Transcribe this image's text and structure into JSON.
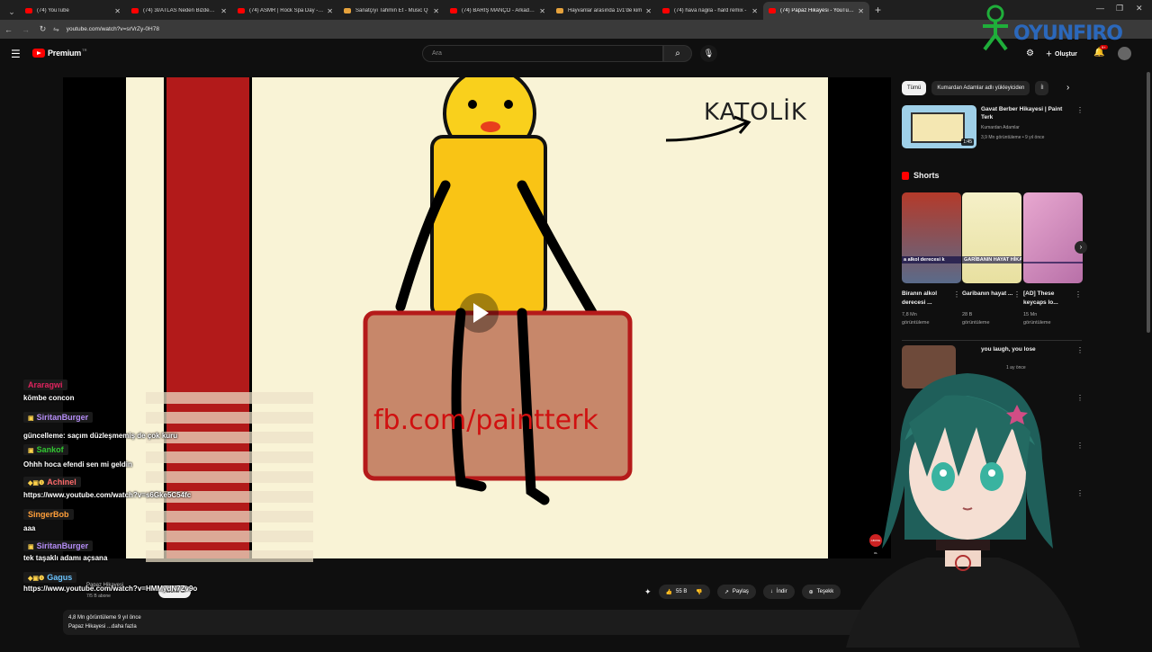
{
  "browser": {
    "tabs": [
      {
        "title": "(74) YouTube",
        "active": false,
        "kind": "yt"
      },
      {
        "title": "(74) 3I/ATLAS Neden Bizden G",
        "active": false,
        "kind": "yt"
      },
      {
        "title": "(74) ASMR | Rock Spa Day - Yo",
        "active": false,
        "kind": "yt"
      },
      {
        "title": "Sanatçıyı Tahmin Et - Music Q",
        "active": false,
        "kind": "other"
      },
      {
        "title": "(74) BARIŞ MANÇO - Arkadaşı",
        "active": false,
        "kind": "yt"
      },
      {
        "title": "Hayvanlar arasında 1v1'de kim",
        "active": false,
        "kind": "other"
      },
      {
        "title": "(74) hava nagila - hard remix -",
        "active": false,
        "kind": "yt"
      },
      {
        "title": "(74) Papaz Hikayesi - YouTube",
        "active": true,
        "kind": "yt"
      }
    ],
    "url": "youtube.com/watch?v=srVrZy-0H78",
    "new_tab": "+"
  },
  "header": {
    "logo_text": "Premium",
    "logo_sup": "TR",
    "search_placeholder": "Ara",
    "create_label": "Oluştur",
    "notif_count": "9+"
  },
  "watermark": {
    "text": "OYUNFIRO"
  },
  "video": {
    "title_sign": "KATOLİK",
    "overlay_text": "fb.com/paintterk",
    "sub_badge": "ABONE OL"
  },
  "below": {
    "channel": "Papaz Hikayesi",
    "subs": "7/5 B abone",
    "subscribe_label": "Abone ol",
    "likes": "55 B",
    "share": "Paylaş",
    "download": "İndir",
    "thanks": "Teşekk",
    "desc_line1": "4,8 Mn görüntüleme  9 yıl önce",
    "desc_line2": "Papaz Hikayesi ...daha fazla"
  },
  "sidebar": {
    "chips": [
      "Tümü",
      "Kumardan Adamlar adlı yükleyiciden",
      "İl"
    ],
    "rec": {
      "title": "Gavat Berber Hikayesi | Paint Terk",
      "channel": "Kumardan Adamlar",
      "meta": "3,9 Mn görüntüleme • 9 yıl önce",
      "duration": "1:45"
    },
    "shorts_header": "Shorts",
    "shorts": [
      {
        "title": "Biranın alkol derecesi ...",
        "views": "7,8 Mn",
        "views2": "görüntüleme",
        "caption": "a alkol derecesi k"
      },
      {
        "title": "Garibanın hayat ...",
        "views": "28 B",
        "views2": "görüntüleme",
        "caption": "GARİBANIN HAYAT HİKAYESİ"
      },
      {
        "title": "[AD] These keycaps lo...",
        "views": "15 Mn",
        "views2": "görüntüleme",
        "caption": ""
      }
    ],
    "recent": {
      "title": "you laugh, you lose",
      "meta": "1 ay önce"
    }
  },
  "chat": [
    {
      "name": "Araragwi",
      "color": "#e0245e",
      "msg": "kömbe concon",
      "badges": ""
    },
    {
      "name": "SiritanBurger",
      "color": "#b48cf5",
      "msg": "güncelleme: saçım düzleşmemiş de çok kuru",
      "badges": "▣"
    },
    {
      "name": "Sankof",
      "color": "#32c832",
      "msg": "Ohhh hoca efendi sen mi geldin",
      "badges": "▣"
    },
    {
      "name": "Achinel",
      "color": "#ff6b6b",
      "msg": "https://www.youtube.com/watch?v=s6Gke5C54fc",
      "badges": "◆▣❶"
    },
    {
      "name": "SingerBob",
      "color": "#ff9f3a",
      "msg": "aaa",
      "badges": ""
    },
    {
      "name": "SiritanBurger",
      "color": "#b48cf5",
      "msg": "tek taşaklı adamı açsana",
      "badges": "▣"
    },
    {
      "name": "Gagus",
      "color": "#6bc4ff",
      "msg": "https://www.youtube.com/watch?v=HMMydN7Zv9o",
      "badges": "◆▣❶"
    }
  ]
}
